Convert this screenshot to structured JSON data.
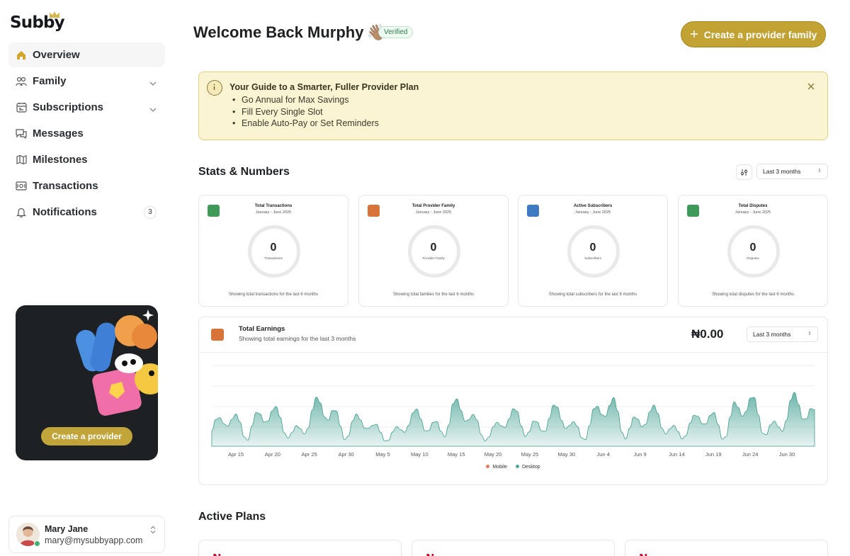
{
  "brand": {
    "name": "Subby"
  },
  "sidebar": {
    "items": [
      {
        "label": "Overview",
        "icon": "home-icon",
        "active": true
      },
      {
        "label": "Family",
        "icon": "family-icon",
        "has_chevron": true
      },
      {
        "label": "Subscriptions",
        "icon": "subscriptions-icon",
        "has_chevron": true
      },
      {
        "label": "Messages",
        "icon": "messages-icon"
      },
      {
        "label": "Milestones",
        "icon": "milestones-icon"
      },
      {
        "label": "Transactions",
        "icon": "transactions-icon"
      },
      {
        "label": "Notifications",
        "icon": "bell-icon",
        "badge": "3"
      }
    ],
    "promo": {
      "button_label": "Create a provider"
    },
    "user": {
      "name": "Mary Jane",
      "email": "mary@mysubbyapp.com",
      "status_color": "#3fb36b"
    }
  },
  "header": {
    "welcome": "Welcome Back Murphy",
    "wave_emoji": "👋🏽",
    "verified_badge": "Verified",
    "create_button": "Create a provider family"
  },
  "guide": {
    "title": "Your Guide to a Smarter, Fuller Provider Plan",
    "tips": [
      "Go Annual for Max Savings",
      "Fill Every Single Slot",
      "Enable Auto-Pay or Set Reminders"
    ]
  },
  "stats": {
    "title": "Stats & Numbers",
    "range": "Last 3 months",
    "cards": [
      {
        "title": "Total Transactions",
        "subtitle": "January - June 2025",
        "value": "0",
        "unit": "Transactions",
        "footer": "Showing total transactions for the last 6 months",
        "color": "#3f9a5a"
      },
      {
        "title": "Total Provider Family",
        "subtitle": "January - June 2025",
        "value": "0",
        "unit": "Provider Family",
        "footer": "Showing total families for the last 6 months",
        "color": "#d8743a"
      },
      {
        "title": "Active Subscribers",
        "subtitle": "January - June 2025",
        "value": "0",
        "unit": "Subscribers",
        "footer": "Showing total subscribers for the last 6 months",
        "color": "#3d7cc4"
      },
      {
        "title": "Total Disputes",
        "subtitle": "January - June 2025",
        "value": "0",
        "unit": "Disputes",
        "footer": "Showing total disputes for the last 6 months",
        "color": "#3f9a5a"
      }
    ]
  },
  "earnings": {
    "title": "Total Earnings",
    "subtitle": "Showing total earnings for the last 3 months",
    "amount": "₦0.00",
    "range": "Last 3 months",
    "legend": [
      {
        "label": "Mobile",
        "color": "#e07b53"
      },
      {
        "label": "Desktop",
        "color": "#4fa89a"
      }
    ]
  },
  "chart_data": {
    "type": "area",
    "x": [
      "Apr 15",
      "Apr 20",
      "Apr 25",
      "Apr 30",
      "May 5",
      "May 10",
      "May 15",
      "May 20",
      "May 25",
      "May 30",
      "Jun 4",
      "Jun 9",
      "Jun 14",
      "Jun 19",
      "Jun 24",
      "Jun 30"
    ],
    "series": [
      {
        "name": "Desktop",
        "values": [
          0.42,
          0.78,
          0.52,
          0.9,
          0.38,
          0.55,
          0.8,
          0.48,
          0.72,
          0.58,
          0.85,
          0.62,
          0.5,
          0.92,
          0.68,
          0.96
        ]
      }
    ],
    "grid": true,
    "legend_position": "bottom"
  },
  "plans": {
    "title": "Active Plans",
    "cards": [
      {
        "logo": "N"
      },
      {
        "logo": "N"
      },
      {
        "logo": "N"
      }
    ]
  }
}
